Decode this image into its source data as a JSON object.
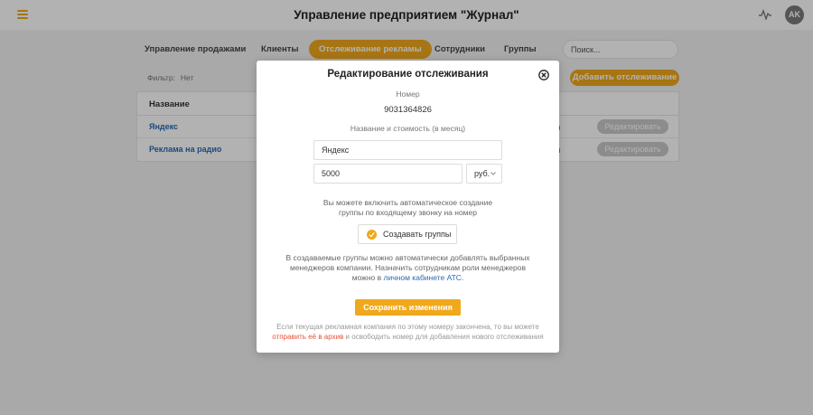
{
  "header": {
    "title": "Управление предприятием \"Журнал\"",
    "avatar_initials": "AK",
    "menu_icon": "hamburger-icon",
    "activity_icon": "pulse-icon",
    "accent_color": "#f0a81c"
  },
  "tabs": [
    {
      "label": "Управление продажами",
      "active": false
    },
    {
      "label": "Клиенты",
      "active": false
    },
    {
      "label": "Отслеживание рекламы",
      "active": true
    },
    {
      "label": "Сотрудники",
      "active": false
    },
    {
      "label": "Группы",
      "active": false
    }
  ],
  "search": {
    "placeholder": "Поиск..."
  },
  "filter": {
    "label": "Фильтр:",
    "value": "Нет"
  },
  "add_button": "Добавить отслеживание",
  "table": {
    "header_name": "Название",
    "rows": [
      {
        "name": "Яндекс",
        "mid": "ы",
        "edit": "Редактировать"
      },
      {
        "name": "Реклама на радио",
        "mid": "ы",
        "edit": "Редактировать"
      }
    ]
  },
  "modal": {
    "title": "Редактирование отслеживания",
    "number_label": "Номер",
    "number_value": "9031364826",
    "name_cost_label": "Название и стоимость (в месяц)",
    "name_value": "Яндекс",
    "cost_value": "5000",
    "currency": "руб.",
    "auto_group_text_1": "Вы можете включить автоматическое создание",
    "auto_group_text_2": "группы по входящему звонку на номер",
    "create_groups_label": "Создавать группы",
    "create_groups_checked": true,
    "managers_text_1": "В создаваемые группы можно автоматически добавлять выбранных",
    "managers_text_2": "менеджеров компании. Назначить сотрудникам роли менеджеров",
    "managers_text_3_pre": "можно в",
    "managers_link": "личном кабинете АТС",
    "managers_text_3_post": ".",
    "save_button": "Сохранить изменения",
    "footer_text_1": "Если текущая рекламная компания по этому номеру закончена, то вы можете",
    "footer_link": "отправить её в архив",
    "footer_text_2_post": "и освободить номер для добавления нового отслеживания"
  }
}
